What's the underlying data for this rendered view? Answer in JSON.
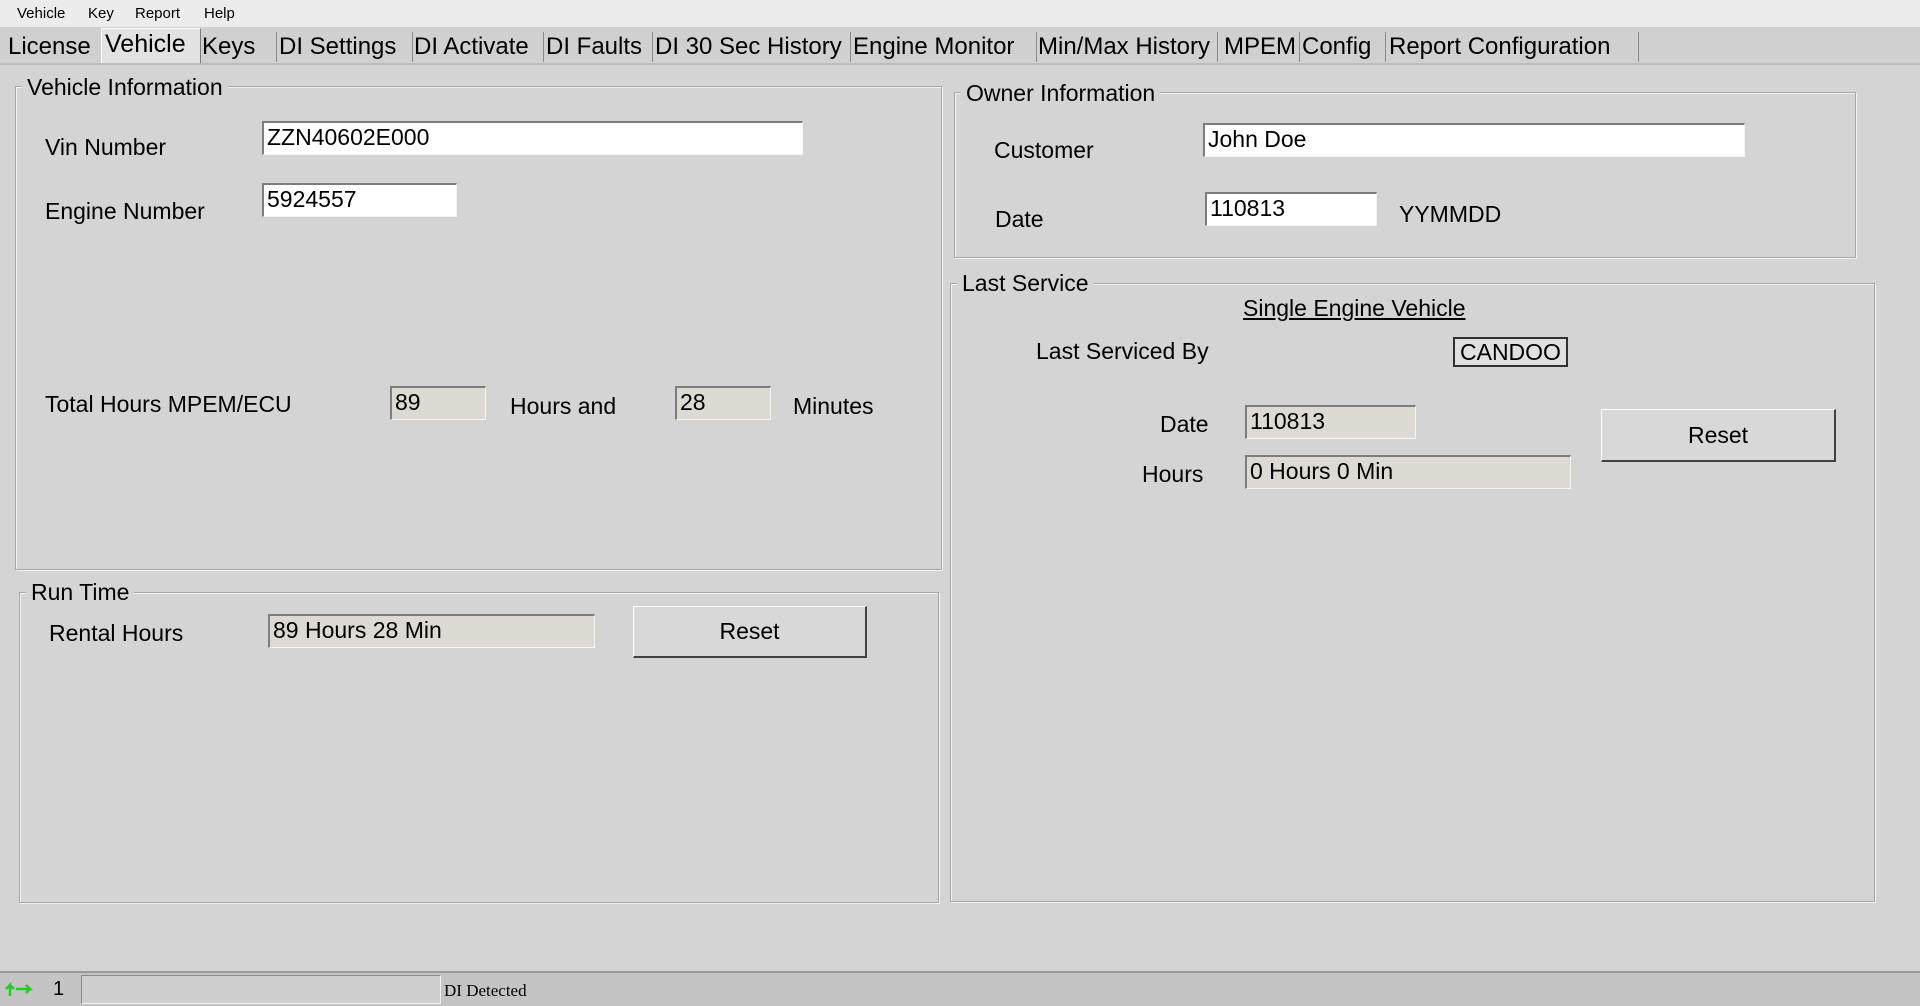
{
  "menu": {
    "vehicle": "Vehicle",
    "key": "Key",
    "report": "Report",
    "help": "Help"
  },
  "tabs": [
    {
      "label": "License"
    },
    {
      "label": "Vehicle"
    },
    {
      "label": "Keys"
    },
    {
      "label": "DI Settings"
    },
    {
      "label": "DI Activate"
    },
    {
      "label": "DI Faults"
    },
    {
      "label": "DI 30 Sec History"
    },
    {
      "label": "Engine Monitor"
    },
    {
      "label": "Min/Max History"
    },
    {
      "label": "MPEM"
    },
    {
      "label": "Config"
    },
    {
      "label": "Report Configuration"
    }
  ],
  "active_tab": "Vehicle",
  "vehicle_info": {
    "legend": "Vehicle Information",
    "vin_label": "Vin Number",
    "vin_value": "ZZN40602E000",
    "engine_label": "Engine Number",
    "engine_value": "5924557",
    "total_hours_label": "Total Hours MPEM/ECU",
    "hours_value": "89",
    "hours_and_label": "Hours and",
    "minutes_value": "28",
    "minutes_label": "Minutes"
  },
  "run_time": {
    "legend": "Run Time",
    "rental_label": "Rental Hours",
    "rental_value": "89 Hours  28 Min",
    "reset_label": "Reset"
  },
  "owner_info": {
    "legend": "Owner Information",
    "customer_label": "Customer",
    "customer_value": "John Doe",
    "date_label": "Date",
    "date_value": "110813",
    "date_format": "YYMMDD"
  },
  "last_service": {
    "legend": "Last Service",
    "heading": "Single Engine Vehicle",
    "serviced_by_label": "Last Serviced By",
    "serviced_by_value": "CANDOO",
    "date_label": "Date",
    "date_value": "110813",
    "hours_label": "Hours",
    "hours_value": "0 Hours  0 Min",
    "reset_label": "Reset"
  },
  "status": {
    "index": "1",
    "message": "DI Detected",
    "connection_icon": "connection-arrows-icon",
    "icon_color": "#22cc22"
  }
}
